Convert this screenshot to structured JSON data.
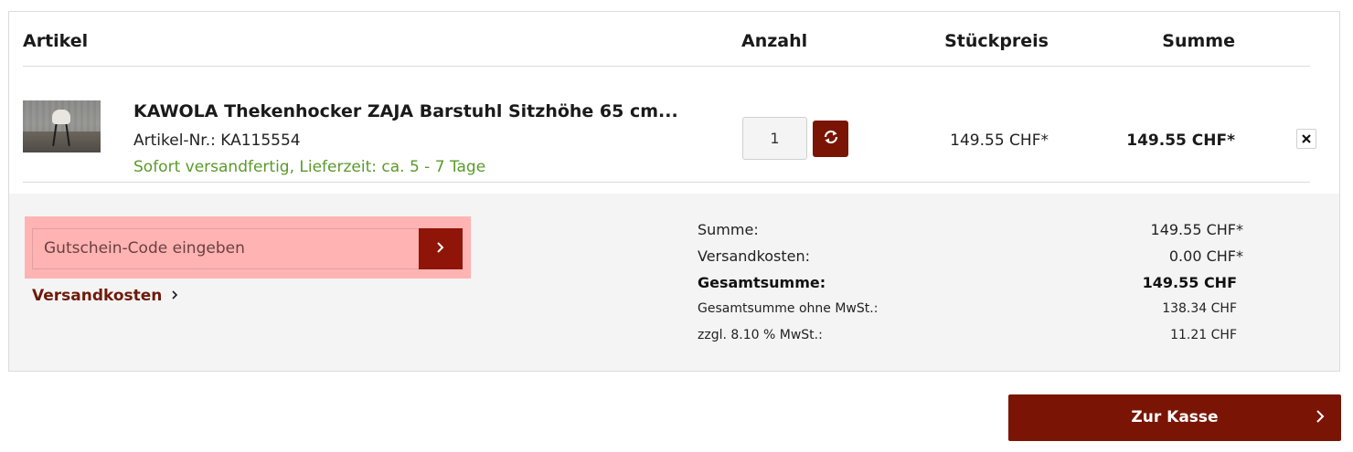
{
  "table_header": {
    "article": "Artikel",
    "quantity": "Anzahl",
    "unit_price": "Stückpreis",
    "sum": "Summe"
  },
  "item": {
    "title": "KAWOLA Thekenhocker ZAJA Barstuhl Sitzhöhe 65 cm...",
    "sku": "Artikel-Nr.: KA115554",
    "delivery": "Sofort versandfertig, Lieferzeit: ca. 5 - 7 Tage",
    "quantity": "1",
    "unit_price": "149.55 CHF*",
    "total": "149.55 CHF*"
  },
  "voucher": {
    "placeholder": "Gutschein-Code eingeben"
  },
  "shipping_link": "Versandkosten",
  "summary": {
    "sum_label": "Summe:",
    "sum_value": "149.55 CHF*",
    "shipping_label": "Versandkosten:",
    "shipping_value": "0.00 CHF*",
    "total_label": "Gesamtsumme:",
    "total_value": "149.55 CHF",
    "net_label": "Gesamtsumme ohne MwSt.:",
    "net_value": "138.34 CHF",
    "vat_label": "zzgl. 8.10 % MwSt.:",
    "vat_value": "11.21 CHF"
  },
  "checkout": {
    "label": "Zur Kasse"
  },
  "colors": {
    "brand": "#7a1505",
    "delivery_green": "#5b9a2b",
    "highlight": "#ffb3b3"
  }
}
